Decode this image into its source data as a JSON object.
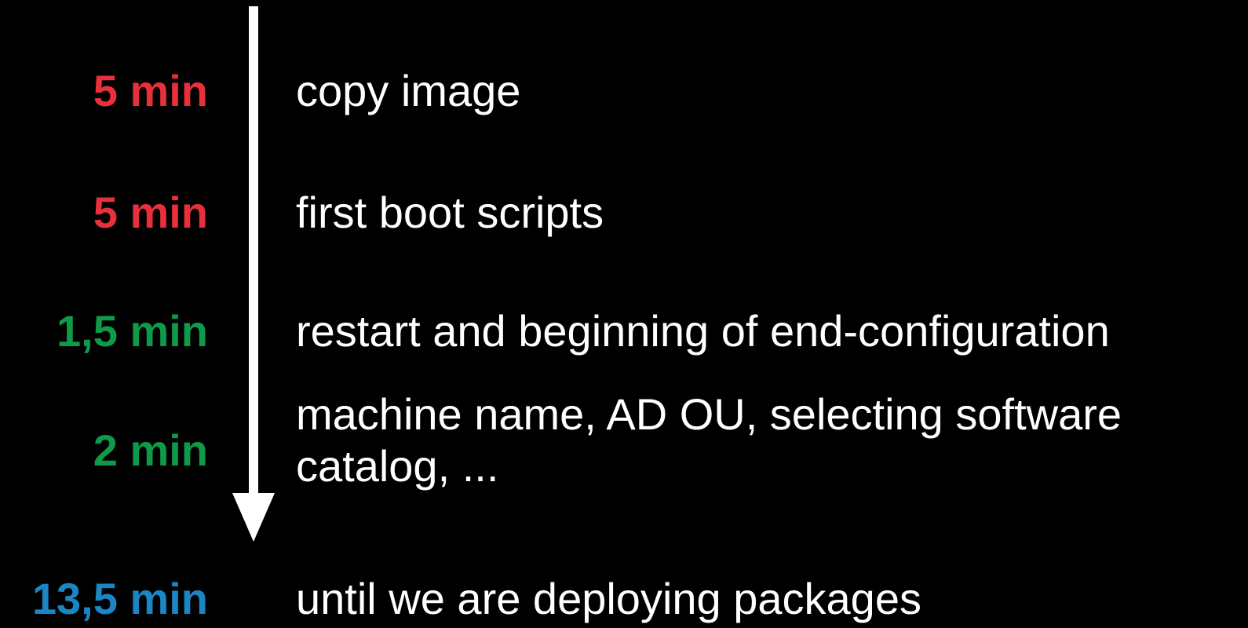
{
  "colors": {
    "background": "#000000",
    "text": "#ffffff",
    "red": "#e8303d",
    "green": "#0f9a4a",
    "blue": "#1a86c4"
  },
  "steps": [
    {
      "time": "5 min",
      "time_color": "#e8303d",
      "label": "copy image"
    },
    {
      "time": "5 min",
      "time_color": "#e8303d",
      "label": "first boot scripts"
    },
    {
      "time": "1,5 min",
      "time_color": "#0f9a4a",
      "label": "restart and beginning of end-configuration"
    },
    {
      "time": "2 min",
      "time_color": "#0f9a4a",
      "label": "machine name, AD OU, selecting software catalog, ..."
    }
  ],
  "total": {
    "time": "13,5 min",
    "time_color": "#1a86c4",
    "label": "until we are deploying packages"
  },
  "arrow": {
    "icon": "down-arrow-icon",
    "color": "#ffffff"
  }
}
